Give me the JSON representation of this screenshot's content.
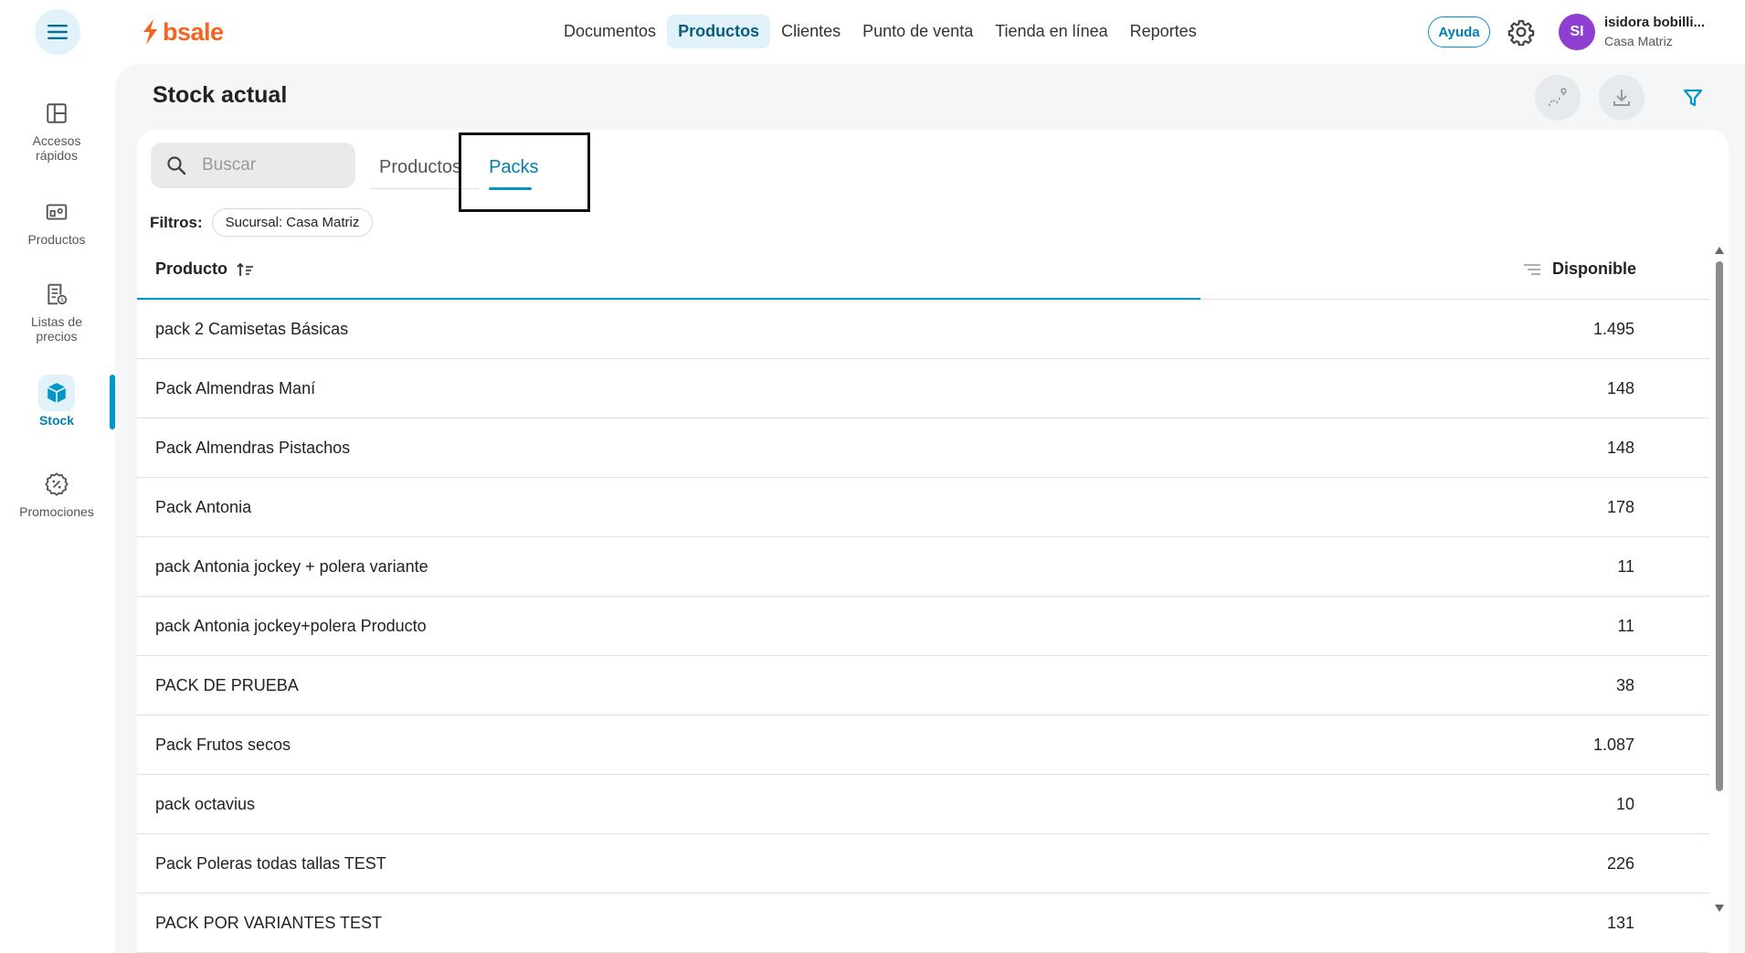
{
  "topbar": {
    "logo_text": "bsale",
    "nav": [
      "Documentos",
      "Productos",
      "Clientes",
      "Punto de venta",
      "Tienda en línea",
      "Reportes"
    ],
    "active_nav": "Productos",
    "help_label": "Ayuda",
    "avatar_initials": "SI",
    "user_name": "isidora bobilli...",
    "user_branch": "Casa Matriz"
  },
  "sidebar": {
    "items": [
      {
        "label": "Accesos rápidos",
        "icon": "layout-icon"
      },
      {
        "label": "Productos",
        "icon": "products-icon"
      },
      {
        "label": "Listas de precios",
        "icon": "price-list-icon"
      },
      {
        "label": "Stock",
        "icon": "box-icon"
      },
      {
        "label": "Promociones",
        "icon": "discount-badge-icon"
      }
    ],
    "active": "Stock"
  },
  "page": {
    "title": "Stock actual",
    "search_placeholder": "Buscar",
    "tabs": [
      "Productos",
      "Packs"
    ],
    "active_tab": "Packs",
    "filters_label": "Filtros:",
    "filter_chip": "Sucursal: Casa Matriz"
  },
  "table": {
    "columns": {
      "product": "Producto",
      "available": "Disponible"
    },
    "rows": [
      {
        "name": "pack 2 Camisetas Básicas",
        "qty": "1.495"
      },
      {
        "name": "Pack Almendras Maní",
        "qty": "148"
      },
      {
        "name": "Pack Almendras Pistachos",
        "qty": "148"
      },
      {
        "name": "Pack Antonia",
        "qty": "178"
      },
      {
        "name": "pack Antonia jockey + polera variante",
        "qty": "11"
      },
      {
        "name": "pack Antonia jockey+polera Producto",
        "qty": "11"
      },
      {
        "name": "PACK DE PRUEBA",
        "qty": "38"
      },
      {
        "name": "Pack Frutos secos",
        "qty": "1.087"
      },
      {
        "name": "pack octavius",
        "qty": "10"
      },
      {
        "name": "Pack Poleras todas tallas TEST",
        "qty": "226"
      },
      {
        "name": "PACK POR VARIANTES TEST",
        "qty": "131"
      }
    ]
  },
  "colors": {
    "accent": "#0096c7",
    "brand": "#f26522",
    "avatar": "#8e3fd1"
  }
}
